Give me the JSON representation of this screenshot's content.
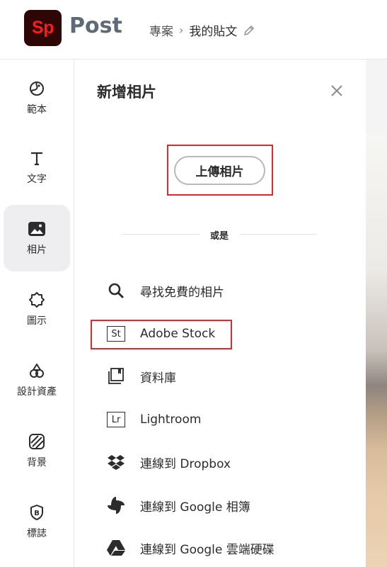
{
  "header": {
    "logo_text": "Sp",
    "app_name": "Post",
    "breadcrumb_parent": "專案",
    "breadcrumb_separator": "›",
    "breadcrumb_current": "我的貼文"
  },
  "rail": {
    "items": [
      {
        "label": "範本",
        "icon": "template-icon"
      },
      {
        "label": "文字",
        "icon": "text-icon"
      },
      {
        "label": "相片",
        "icon": "image-icon",
        "active": true
      },
      {
        "label": "圖示",
        "icon": "shape-icon"
      },
      {
        "label": "設計資產",
        "icon": "design-assets-icon"
      },
      {
        "label": "背景",
        "icon": "background-icon"
      },
      {
        "label": "標誌",
        "icon": "brand-icon"
      }
    ]
  },
  "panel": {
    "title": "新增相片",
    "upload_label": "上傳相片",
    "or_label": "或是",
    "sources": [
      {
        "label": "尋找免費的相片",
        "icon": "search-icon"
      },
      {
        "label": "Adobe Stock",
        "icon": "adobe-stock-icon",
        "badge": "St"
      },
      {
        "label": "資料庫",
        "icon": "libraries-icon"
      },
      {
        "label": "Lightroom",
        "icon": "lightroom-icon",
        "badge": "Lr"
      },
      {
        "label": "連線到 Dropbox",
        "icon": "dropbox-icon"
      },
      {
        "label": "連線到 Google 相簿",
        "icon": "google-photos-icon"
      },
      {
        "label": "連線到 Google 雲端硬碟",
        "icon": "google-drive-icon"
      }
    ]
  },
  "colors": {
    "accent_highlight": "#e0282d",
    "logo_bg": "#2e0606",
    "logo_text": "#ff1a1a",
    "active_rail_bg": "#eeeef0"
  }
}
